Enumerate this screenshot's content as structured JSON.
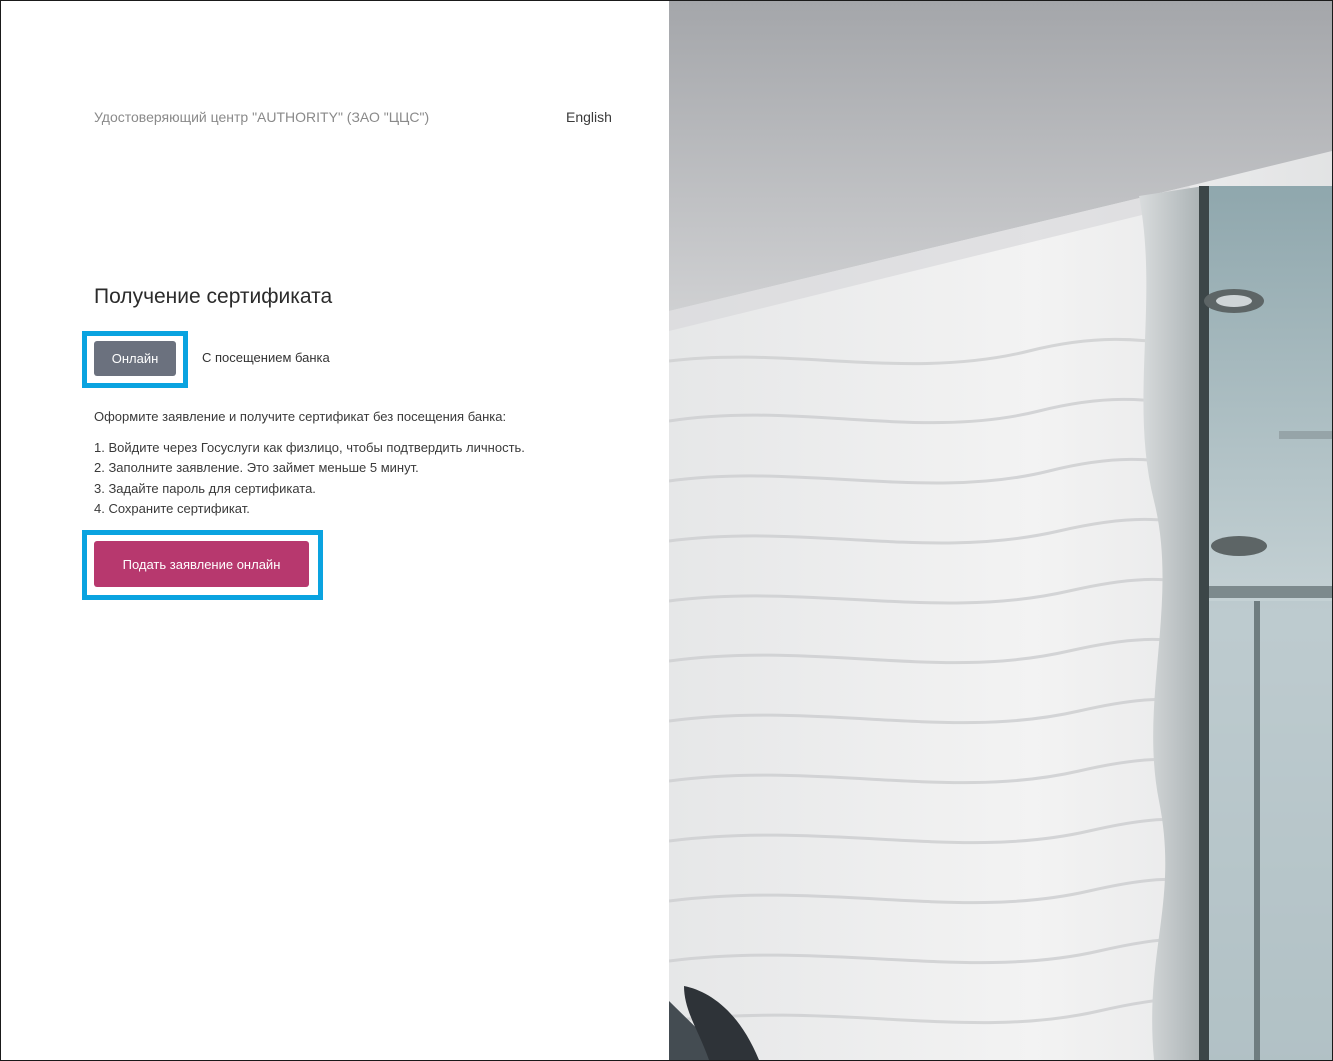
{
  "header": {
    "org_name": "Удостоверяющий центр \"AUTHORITY\" (ЗАО \"ЦЦС\")",
    "language_link": "English"
  },
  "page": {
    "title": "Получение сертификата"
  },
  "tabs": {
    "online": "Онлайн",
    "bank": "С посещением банка",
    "selected": "online"
  },
  "content": {
    "intro": "Оформите заявление и получите сертификат без посещения банка:",
    "steps": [
      "1. Войдите через Госуслуги как физлицо, чтобы подтвердить личность.",
      "2. Заполните заявление. Это займет меньше 5 минут.",
      "3. Задайте пароль для сертификата.",
      "4. Сохраните сертификат."
    ]
  },
  "actions": {
    "submit_label": "Подать заявление онлайн"
  },
  "colors": {
    "accent": "#b7386e",
    "tab_active": "#6b717e",
    "highlight": "#0aa3e0"
  }
}
